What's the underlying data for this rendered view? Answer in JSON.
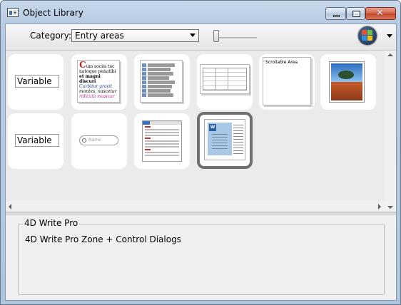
{
  "window": {
    "title": "Object Library"
  },
  "toolbar": {
    "category_label": "Category:",
    "category_value": "Entry areas"
  },
  "tiles": [
    {
      "kind": "variable",
      "text": "Variable"
    },
    {
      "kind": "styled-text",
      "big": "C",
      "lines": [
        "um sociis tuc",
        "natoque penatibi",
        "et magni discuri",
        "Curbitur gravit",
        "montes, nascetur",
        "ridicula musicar"
      ]
    },
    {
      "kind": "hierarchical-list"
    },
    {
      "kind": "list-box"
    },
    {
      "kind": "scrollable-area",
      "text": "Scrollable Area"
    },
    {
      "kind": "picture"
    },
    {
      "kind": "variable",
      "text": "Variable"
    },
    {
      "kind": "search-field",
      "placeholder": "Name"
    },
    {
      "kind": "write-doc"
    },
    {
      "kind": "write-pro",
      "selected": true,
      "icon_letter": "W"
    }
  ],
  "info": {
    "title": "4D Write Pro",
    "description": "4D Write Pro Zone + Control Dialogs"
  }
}
